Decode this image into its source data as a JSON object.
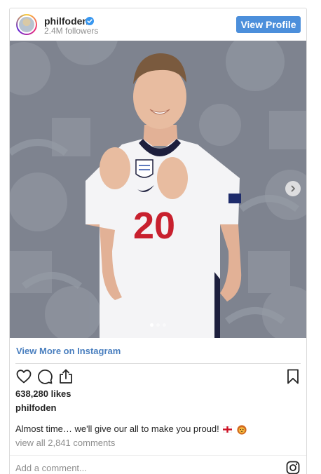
{
  "profile": {
    "username": "philfoden",
    "followers": "2.4M followers",
    "verified": true,
    "view_profile_label": "View Profile"
  },
  "post": {
    "photo_alt": "philfoden",
    "carousel_total": 3,
    "carousel_active": 1,
    "shirt_number": "20",
    "view_more_label": "View More on Instagram",
    "likes": "638,280 likes",
    "owner": "philfoden",
    "caption": "Almost time… we'll give our all to make you proud!",
    "comments_link": "view all 2,841 comments",
    "comment_placeholder": "Add a comment..."
  },
  "icons": {
    "like": "heart-icon",
    "comment": "comment-icon",
    "share": "share-icon",
    "save": "bookmark-icon",
    "instagram": "instagram-icon",
    "next": "chevron-right-icon",
    "verified": "verified-badge-icon",
    "flag": "england-flag-icon",
    "emoji": "lion-face-icon"
  },
  "colors": {
    "accent_button": "#4c8fdb",
    "link": "#4a7fbf",
    "verified": "#3897f0",
    "muted_text": "#8e8e8e",
    "border": "#dbdbdb"
  }
}
